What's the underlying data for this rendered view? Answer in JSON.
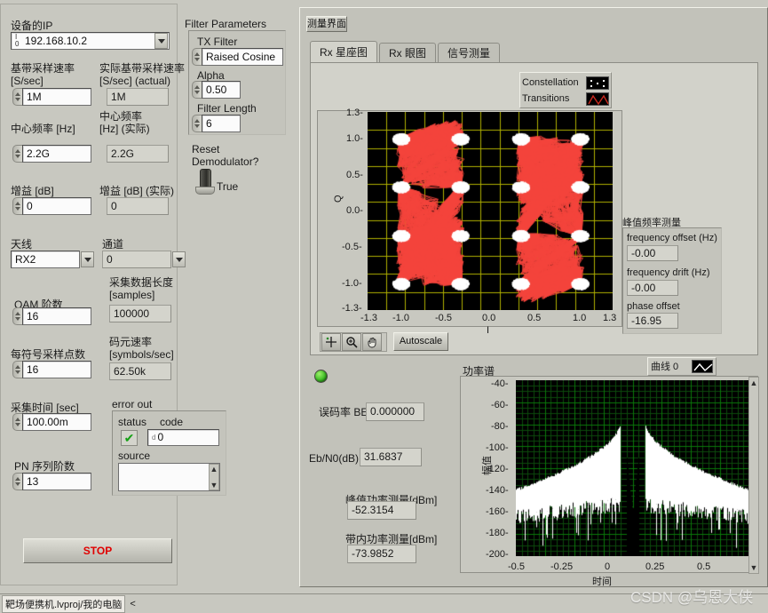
{
  "window": {
    "background": "#c8c8c0",
    "status_project": "靶场便携机.lvproj/我的电脑",
    "status_more": "<",
    "watermark": "CSDN @乌恩大侠"
  },
  "device_panel": {
    "ip_label": "设备的IP",
    "ip_value": "192.168.10.2",
    "ip_prefix_icon": "io-ref-icon",
    "fields": [
      {
        "label_line1": "基带采样速率",
        "label_line2": "[S/sec]",
        "value": "1M",
        "kind": "control"
      },
      {
        "label_line1": "实际基带采样速率",
        "label_line2": " [S/sec] (actual)",
        "value": "1M",
        "kind": "indicator"
      },
      {
        "label_line1": "中心频率 [Hz]",
        "label_line2": "",
        "value": "2.2G",
        "kind": "control"
      },
      {
        "label_line1": "中心频率",
        "label_line2": "[Hz] (实际)",
        "value": "2.2G",
        "kind": "indicator"
      },
      {
        "label_line1": "增益 [dB]",
        "label_line2": "",
        "value": "0",
        "kind": "control"
      },
      {
        "label_line1": "增益 [dB] (实际)",
        "label_line2": "",
        "value": "0",
        "kind": "indicator"
      }
    ],
    "antenna_label": "天线",
    "antenna_value": "RX2",
    "channel_label": "通道",
    "channel_value": "0",
    "qam_label": "QAM 阶数",
    "qam_value": "16",
    "samples_label_line1": "采集数据长度",
    "samples_label_line2": "[samples]",
    "samples_value": "100000",
    "sps_label": "每符号采样点数",
    "sps_value": "16",
    "symrate_label_line1": "码元速率",
    "symrate_label_line2": "[symbols/sec]",
    "symrate_value": "62.50k",
    "acqtime_label": "采集时间 [sec]",
    "acqtime_value": "100.00m",
    "pn_label": "PN 序列阶数",
    "pn_value": "13",
    "stop_label": "STOP",
    "stop_color": "#e00000"
  },
  "error_out": {
    "title": "error out",
    "status_label": "status",
    "status_icon": "check-mark-icon",
    "code_label": "code",
    "code_value": "0",
    "code_prefix": "d",
    "source_label": "source",
    "source_value": ""
  },
  "filter_panel": {
    "title": "Filter Parameters",
    "fields": [
      {
        "label": "TX Filter",
        "value": "Raised Cosine"
      },
      {
        "label": "Alpha",
        "value": "0.50"
      },
      {
        "label": "Filter Length",
        "value": "6"
      }
    ],
    "reset_label_line1": "Reset",
    "reset_label_line2": "Demodulator?",
    "switch_value": "True"
  },
  "measurement": {
    "panel_title": "测量界面",
    "tabs": [
      {
        "label": "Rx 星座图",
        "active": true
      },
      {
        "label": "Rx 眼图",
        "active": false
      },
      {
        "label": "信号测量",
        "active": false
      }
    ]
  },
  "constellation": {
    "legend": [
      {
        "label": "Constellation",
        "style": "dots",
        "color": "#ffffff"
      },
      {
        "label": "Transitions",
        "style": "line",
        "color": "#c8281e"
      }
    ],
    "autoscale_label": "Autoscale",
    "tools": [
      {
        "name": "cursor-tool-icon"
      },
      {
        "name": "zoom-tool-icon"
      },
      {
        "name": "pan-tool-icon"
      }
    ]
  },
  "peak_freq": {
    "title": "峰值频率测量",
    "items": [
      {
        "label": "frequency offset (Hz)",
        "value": "-0.00"
      },
      {
        "label": "frequency drift (Hz)",
        "value": "-0.00"
      },
      {
        "label": "phase offset",
        "value": "-16.95"
      }
    ]
  },
  "results": {
    "ber_label": "误码率 BER",
    "ber_value": "0.000000",
    "ebn0_label": "Eb/N0(dB)",
    "ebn0_value": "31.6837",
    "peak_power_label": "峰值功率测量[dBm]",
    "peak_power_value": "-52.3154",
    "inband_power_label": "带内功率测量[dBm]",
    "inband_power_value": "-73.9852"
  },
  "spectrum": {
    "title": "功率谱",
    "legend_label": "曲线 0",
    "legend_color": "#ffffff"
  },
  "chart_data": [
    {
      "type": "scatter",
      "title": "Rx 星座图",
      "xlabel": "I",
      "ylabel": "Q",
      "xlim": [
        -1.3,
        1.3
      ],
      "ylim": [
        -1.3,
        1.3
      ],
      "xticks": [
        "-1.3",
        "-1.0",
        "-0.5",
        "0.0",
        "0.5",
        "1.0",
        "1.3"
      ],
      "yticks": [
        "1.3",
        "1.0",
        "0.5",
        "0.0",
        "-0.5",
        "-1.0",
        "-1.3"
      ],
      "grid": true,
      "grid_color": "#b0b000",
      "background": "#000000",
      "legend_position": "top-right",
      "series": [
        {
          "name": "Transitions",
          "color": "#f4443c",
          "style": "line"
        },
        {
          "name": "Constellation",
          "color": "#ffffff",
          "style": "dots",
          "points": [
            [
              -0.95,
              0.95
            ],
            [
              -0.32,
              0.95
            ],
            [
              0.32,
              0.95
            ],
            [
              0.95,
              0.95
            ],
            [
              -0.95,
              0.32
            ],
            [
              -0.32,
              0.32
            ],
            [
              0.32,
              0.32
            ],
            [
              0.95,
              0.32
            ],
            [
              -0.95,
              -0.32
            ],
            [
              -0.32,
              -0.32
            ],
            [
              0.32,
              -0.32
            ],
            [
              0.95,
              -0.32
            ],
            [
              -0.95,
              -0.95
            ],
            [
              -0.32,
              -0.95
            ],
            [
              0.32,
              -0.95
            ],
            [
              0.95,
              -0.95
            ]
          ]
        }
      ]
    },
    {
      "type": "line",
      "title": "功率谱",
      "xlabel": "时间",
      "ylabel": "幅值",
      "xlim": [
        -0.5,
        0.5
      ],
      "ylim": [
        -200,
        -40
      ],
      "xticks": [
        "-0.5",
        "-0.25",
        "0",
        "0.25",
        "0.5"
      ],
      "yticks": [
        "-40",
        "-60",
        "-80",
        "-100",
        "-120",
        "-140",
        "-160",
        "-180",
        "-200"
      ],
      "grid": true,
      "grid_color": "#0a7a0a",
      "background": "#000000",
      "series": [
        {
          "name": "曲线 0",
          "color": "#ffffff",
          "style": "line",
          "peak_db": -52.3,
          "noise_floor_db": -160,
          "shoulder_db": -125
        }
      ]
    }
  ]
}
